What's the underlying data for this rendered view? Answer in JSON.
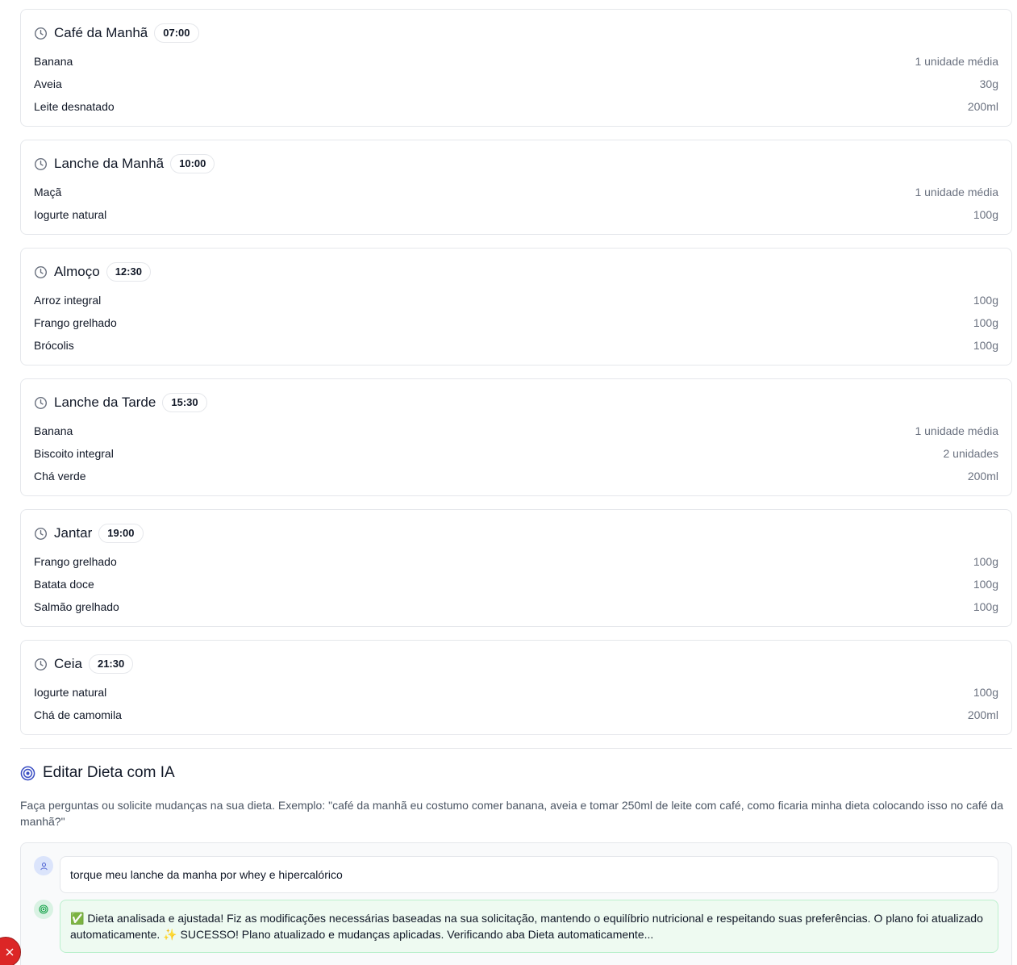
{
  "meals": [
    {
      "title": "Café da Manhã",
      "time": "07:00",
      "foods": [
        {
          "name": "Banana",
          "qty": "1 unidade média"
        },
        {
          "name": "Aveia",
          "qty": "30g"
        },
        {
          "name": "Leite desnatado",
          "qty": "200ml"
        }
      ]
    },
    {
      "title": "Lanche da Manhã",
      "time": "10:00",
      "foods": [
        {
          "name": "Maçã",
          "qty": "1 unidade média"
        },
        {
          "name": "Iogurte natural",
          "qty": "100g"
        }
      ]
    },
    {
      "title": "Almoço",
      "time": "12:30",
      "foods": [
        {
          "name": "Arroz integral",
          "qty": "100g"
        },
        {
          "name": "Frango grelhado",
          "qty": "100g"
        },
        {
          "name": "Brócolis",
          "qty": "100g"
        }
      ]
    },
    {
      "title": "Lanche da Tarde",
      "time": "15:30",
      "foods": [
        {
          "name": "Banana",
          "qty": "1 unidade média"
        },
        {
          "name": "Biscoito integral",
          "qty": "2 unidades"
        },
        {
          "name": "Chá verde",
          "qty": "200ml"
        }
      ]
    },
    {
      "title": "Jantar",
      "time": "19:00",
      "foods": [
        {
          "name": "Frango grelhado",
          "qty": "100g"
        },
        {
          "name": "Batata doce",
          "qty": "100g"
        },
        {
          "name": "Salmão grelhado",
          "qty": "100g"
        }
      ]
    },
    {
      "title": "Ceia",
      "time": "21:30",
      "foods": [
        {
          "name": "Iogurte natural",
          "qty": "100g"
        },
        {
          "name": "Chá de camomila",
          "qty": "200ml"
        }
      ]
    }
  ],
  "ai_editor": {
    "title": "Editar Dieta com IA",
    "description": "Faça perguntas ou solicite mudanças na sua dieta. Exemplo: \"café da manhã eu costumo comer banana, aveia e tomar 250ml de leite com café, como ficaria minha dieta colocando isso no café da manhã?\"",
    "user_message": "torque meu lanche da manha por whey e hipercalórico",
    "ai_message": "✅ Dieta analisada e ajustada! Fiz as modificações necessárias baseadas na sua solicitação, mantendo o equilíbrio nutricional e respeitando suas preferências. O plano foi atualizado automaticamente. ✨ SUCESSO! Plano atualizado e mudanças aplicadas. Verificando aba Dieta automaticamente..."
  },
  "icons": {
    "meal_clock": "clock-icon",
    "section": "target-icon",
    "user_avatar": "user-icon",
    "ai_avatar": "ai-target-icon",
    "close": "close-icon"
  },
  "colors": {
    "accent": "#3b4fc4",
    "success_bg": "#eefaf1",
    "success_border": "#bbf0cd",
    "danger": "#dc2626"
  }
}
